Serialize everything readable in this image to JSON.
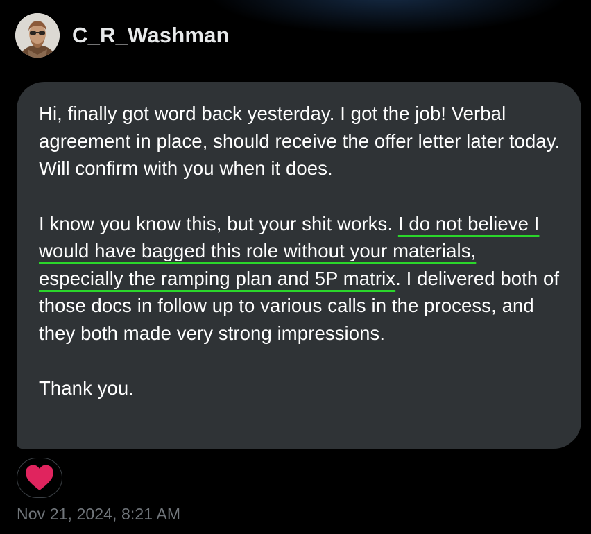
{
  "header": {
    "username": "C_R_Washman"
  },
  "message": {
    "p1": "Hi, finally got word back yesterday. I got the job! Verbal agreement in place, should receive the offer letter later today. Will confirm with you when it does.",
    "p2_before": "I know you know this, but your shit works. ",
    "p2_highlight": "I do not believe I would have bagged this role without your materials, especially the ramping plan and 5P matrix",
    "p2_after": ". I delivered both of those docs in follow up to various calls in the process, and they both made very strong impressions.",
    "p3": "Thank you."
  },
  "reaction": {
    "icon": "heart-icon",
    "color": "#e0245e"
  },
  "timestamp": "Nov 21, 2024, 8:21 AM",
  "colors": {
    "background": "#000000",
    "bubble": "#2f3336",
    "text": "#ffffff",
    "muted": "#71767b",
    "underline": "#2bd62b"
  }
}
